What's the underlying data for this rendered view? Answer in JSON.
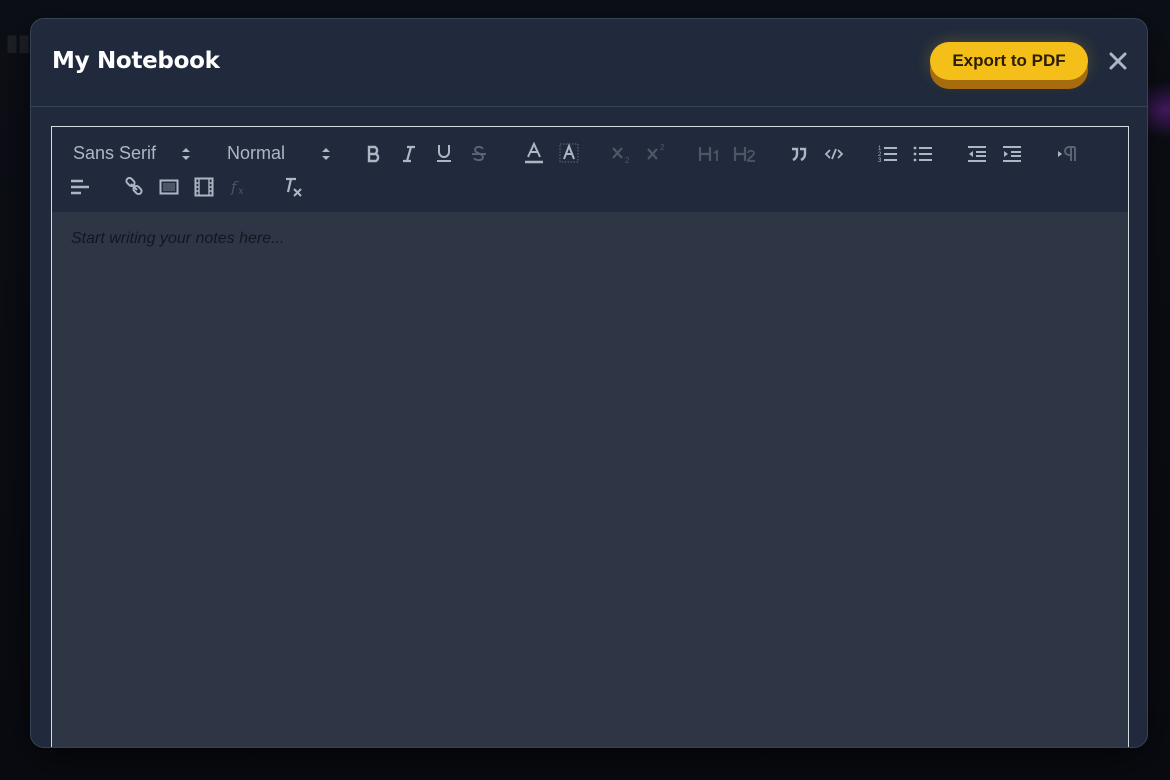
{
  "modal": {
    "title": "My Notebook",
    "export_label": "Export to PDF"
  },
  "toolbar": {
    "font_family": "Sans Serif",
    "font_size": "Normal"
  },
  "editor": {
    "placeholder": "Start writing your notes here..."
  },
  "colors": {
    "modal_bg": "#202a3c",
    "editor_bg": "#2e3646",
    "accent": "#f5bf19",
    "icon": "#aeb6c3",
    "icon_disabled": "#4e5666"
  }
}
